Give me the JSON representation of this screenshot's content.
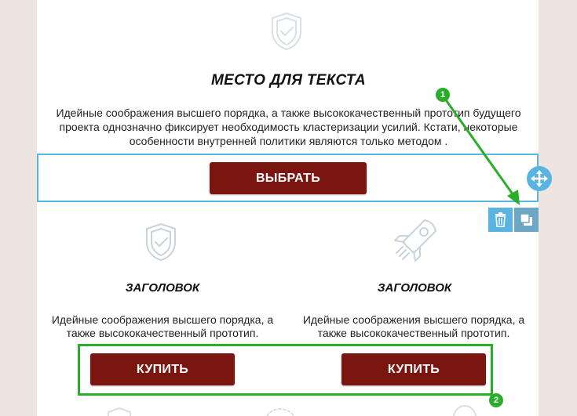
{
  "hero": {
    "title": "МЕСТО ДЛЯ ТЕКСТА",
    "text_line1": "Идейные соображения высшего порядка, а также высококачественный прототип будущего",
    "text_line2": "проекта однозначно фиксирует необходимость кластеризации усилий. Кстати, некоторые",
    "text_line3": "особенности внутренней политики являются только методом .",
    "button_label": "ВЫБРАТЬ"
  },
  "columns": [
    {
      "title": "ЗАГОЛОВОК",
      "text_line1": "Идейные соображения высшего порядка, а",
      "text_line2": "также высококачественный прототип.",
      "button_label": "КУПИТЬ",
      "icon": "shield-check-icon"
    },
    {
      "title": "ЗАГОЛОВОК",
      "text_line1": "Идейные соображения высшего порядка, а",
      "text_line2": "также высококачественный прототип.",
      "button_label": "КУПИТЬ",
      "icon": "rocket-icon"
    }
  ],
  "annotations": {
    "badge1": "1",
    "badge2": "2"
  },
  "toolbar": {
    "move": "move-icon",
    "delete": "trash-icon",
    "copy": "copy-icon"
  },
  "colors": {
    "button": "#7a1510",
    "selection": "#58b6e3",
    "annotation": "#2aae2a",
    "background": "#ece6df"
  }
}
